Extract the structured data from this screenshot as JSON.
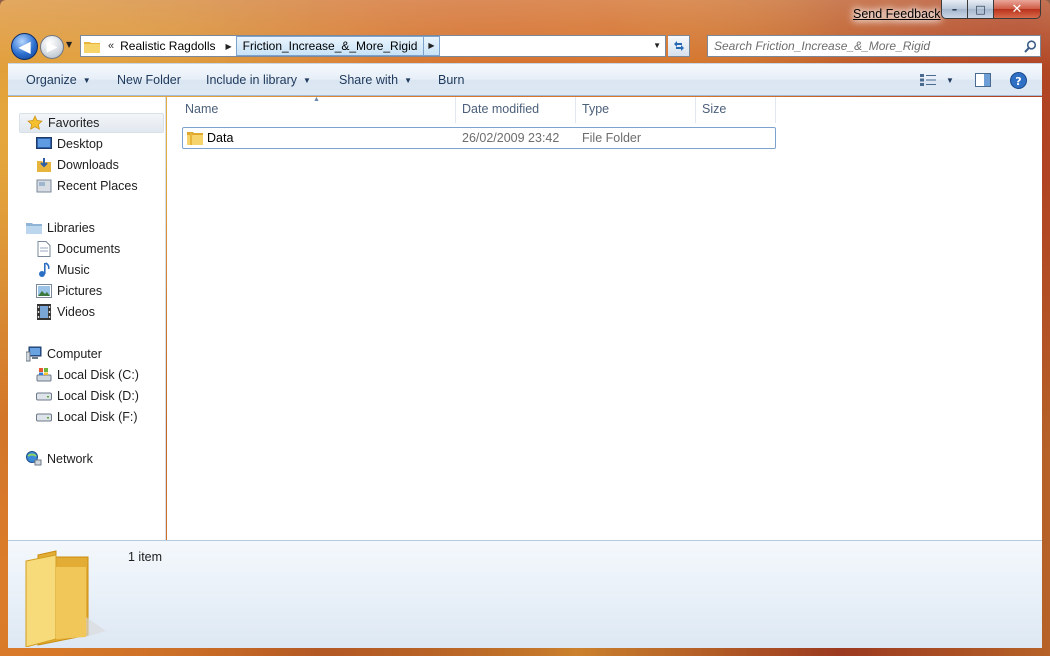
{
  "window": {
    "send_feedback": "Send Feedback",
    "caption": {
      "minimize": "–",
      "maximize": "□",
      "close": "✕"
    }
  },
  "address_bar": {
    "overflow": "«",
    "crumbs": [
      "Realistic Ragdolls",
      "Friction_Increase_&_More_Rigid"
    ],
    "separator": "▶",
    "dropdown": "▼"
  },
  "search": {
    "placeholder": "Search Friction_Increase_&_More_Rigid"
  },
  "toolbar": {
    "organize": "Organize",
    "new_folder": "New Folder",
    "include_in_library": "Include in library",
    "share_with": "Share with",
    "burn": "Burn",
    "caret": "▼"
  },
  "sidebar": {
    "favorites": {
      "label": "Favorites",
      "items": [
        "Desktop",
        "Downloads",
        "Recent Places"
      ]
    },
    "libraries": {
      "label": "Libraries",
      "items": [
        "Documents",
        "Music",
        "Pictures",
        "Videos"
      ]
    },
    "computer": {
      "label": "Computer",
      "items": [
        "Local Disk (C:)",
        "Local Disk (D:)",
        "Local Disk (F:)"
      ]
    },
    "network": {
      "label": "Network"
    }
  },
  "columns": [
    "Name",
    "Date modified",
    "Type",
    "Size"
  ],
  "files": [
    {
      "name": "Data",
      "date_modified": "26/02/2009 23:42",
      "type": "File Folder",
      "size": ""
    }
  ],
  "details": {
    "count": "1 item"
  },
  "colors": {
    "toolbar_text": "#1e395b",
    "selection_border": "#7da2ce",
    "muted_text": "#6d6d6d",
    "folder": "#f2c94c"
  }
}
